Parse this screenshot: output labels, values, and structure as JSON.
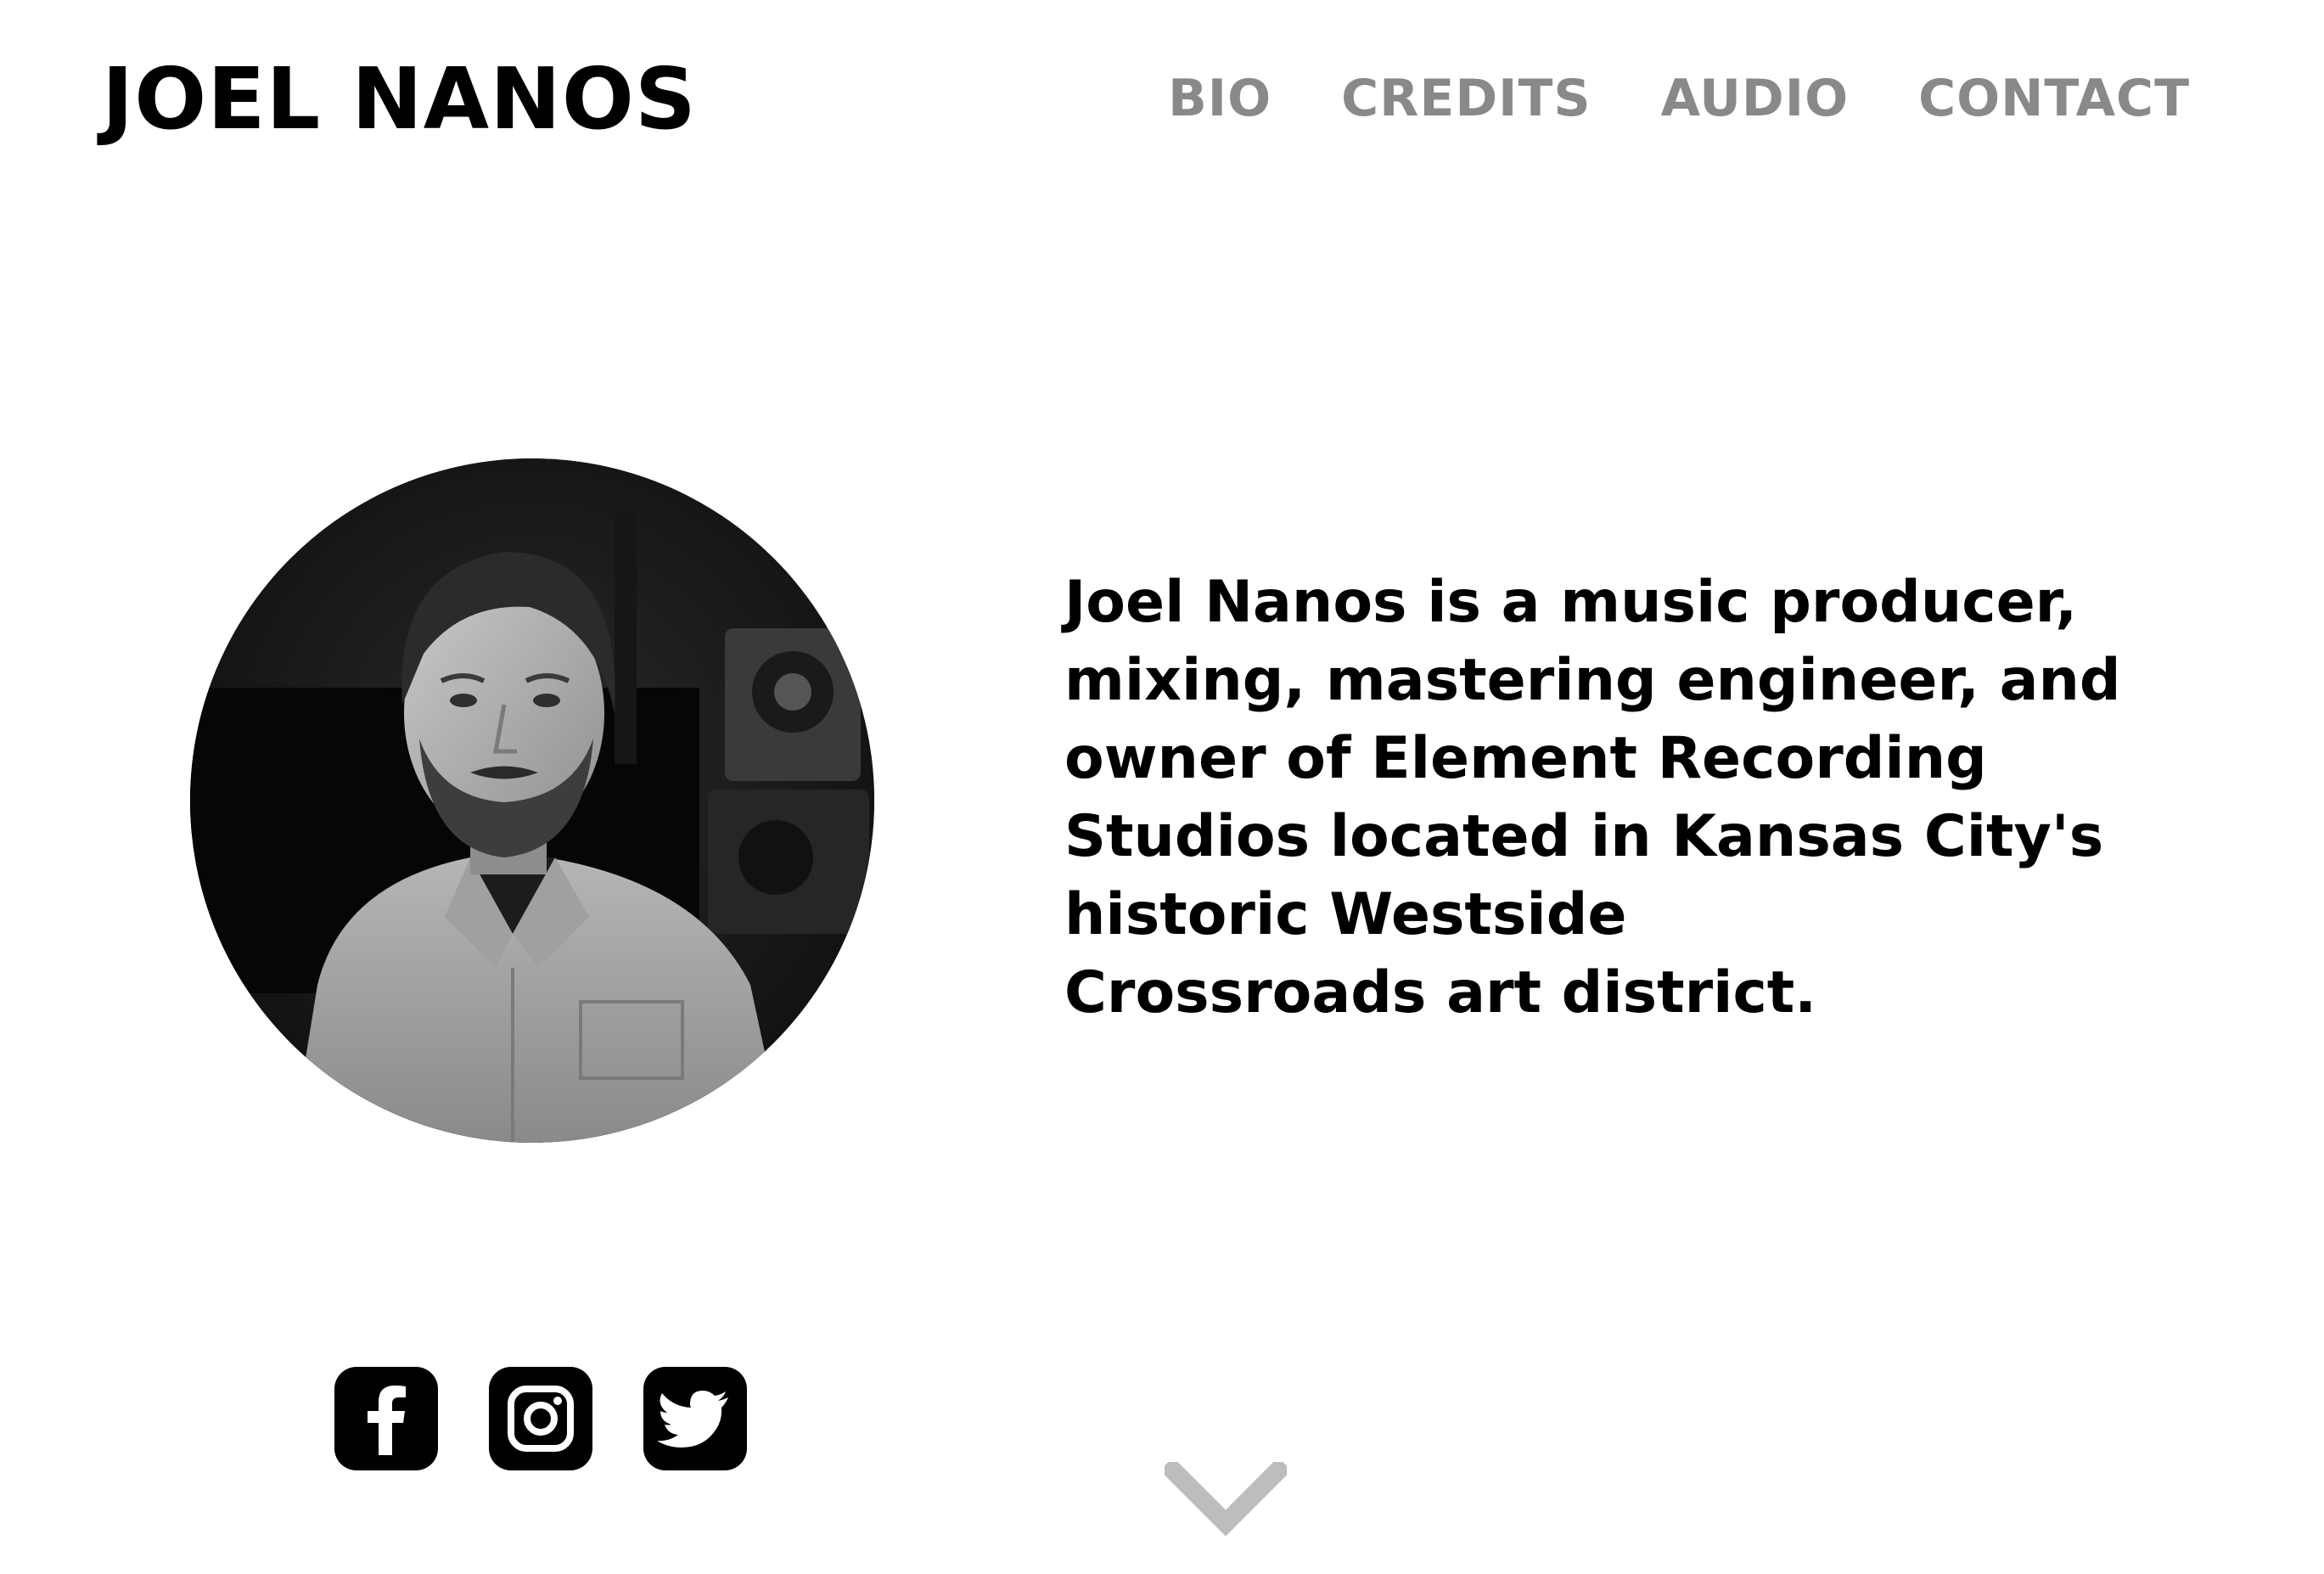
{
  "header": {
    "title": "JOEL NANOS",
    "nav": [
      {
        "label": "BIO"
      },
      {
        "label": "CREDITS"
      },
      {
        "label": "AUDIO"
      },
      {
        "label": "CONTACT"
      }
    ]
  },
  "main": {
    "portrait_icon": "profile-photo",
    "bio_lines": [
      "Joel Nanos is a music producer,",
      "mixing, mastering engineer, and",
      "owner of Element Recording",
      "Studios located in Kansas City's",
      "historic Westside",
      "Crossroads art district."
    ]
  },
  "social": {
    "icons": [
      "facebook-icon",
      "instagram-icon",
      "twitter-icon"
    ]
  },
  "scroll": {
    "icon": "chevron-down-icon",
    "color": "#bdbdbd"
  },
  "colors": {
    "nav_text": "#898989",
    "text": "#000000",
    "background": "#ffffff"
  }
}
